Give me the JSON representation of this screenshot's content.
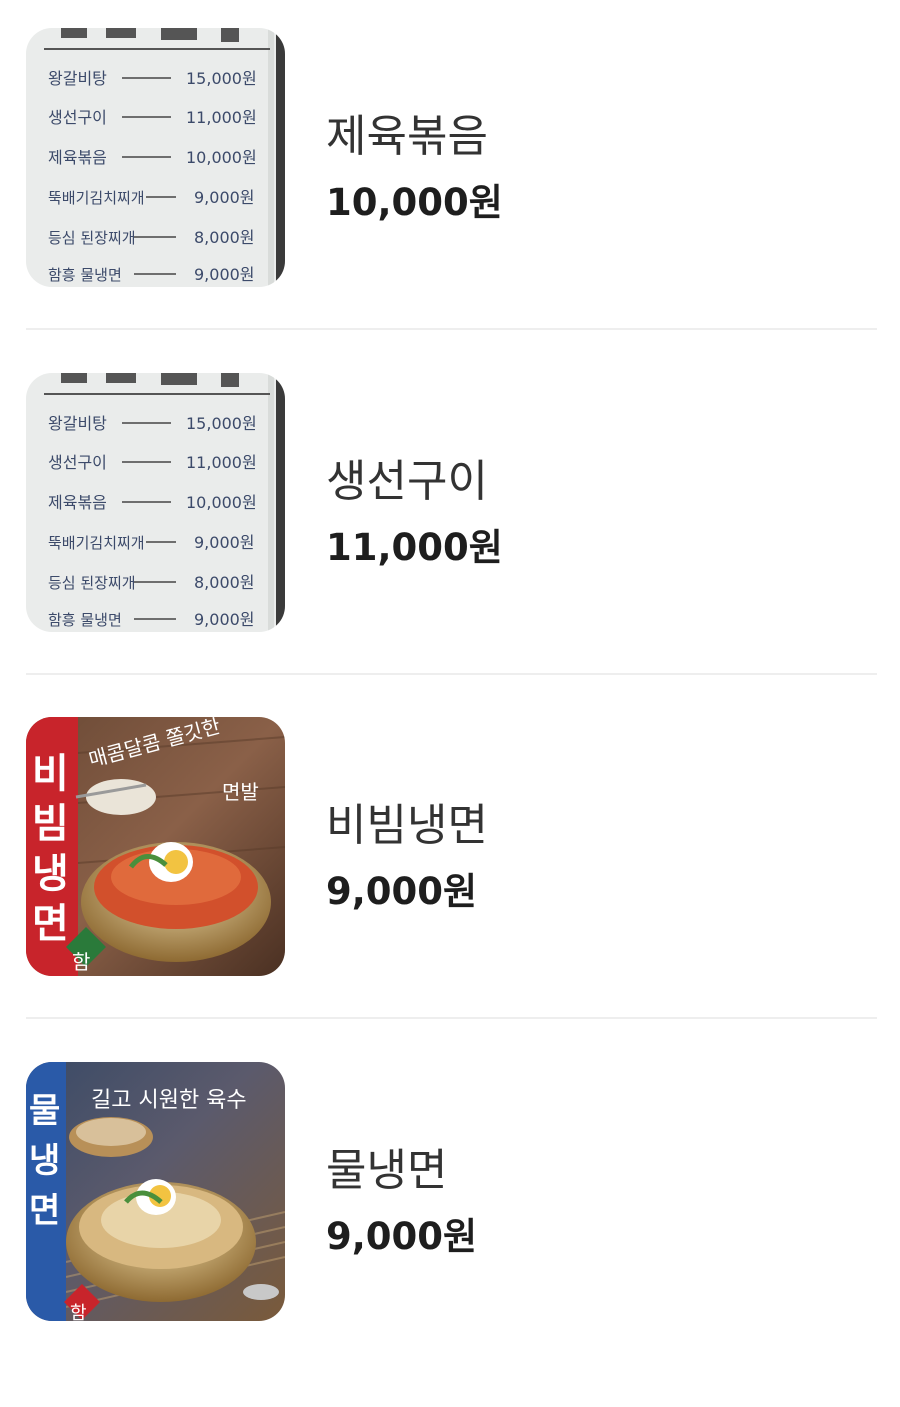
{
  "menu": {
    "items": [
      {
        "name": "제육볶음",
        "price": "10,000원",
        "photo": "menu-board-photo",
        "board": {
          "rows": [
            {
              "name": "왕갈비탕",
              "price": "15,000원"
            },
            {
              "name": "생선구이",
              "price": "11,000원"
            },
            {
              "name": "제육볶음",
              "price": "10,000원"
            },
            {
              "name": "뚝배기김치찌개",
              "price": "9,000원"
            },
            {
              "name": "등심 된장찌개",
              "price": "8,000원"
            },
            {
              "name": "함흥 물냉면",
              "price": "9,000원"
            }
          ]
        }
      },
      {
        "name": "생선구이",
        "price": "11,000원",
        "photo": "menu-board-photo",
        "board": {
          "rows": [
            {
              "name": "왕갈비탕",
              "price": "15,000원"
            },
            {
              "name": "생선구이",
              "price": "11,000원"
            },
            {
              "name": "제육볶음",
              "price": "10,000원"
            },
            {
              "name": "뚝배기김치찌개",
              "price": "9,000원"
            },
            {
              "name": "등심 된장찌개",
              "price": "8,000원"
            },
            {
              "name": "함흥 물냉면",
              "price": "9,000원"
            }
          ]
        }
      },
      {
        "name": "비빔냉면",
        "price": "9,000원",
        "photo": "bibim-naengmyeon-photo",
        "poster": {
          "title": "비빔냉면",
          "slogan_line1": "매콤달콤 쫄깃한",
          "slogan_line2": "면발",
          "badge": "함"
        }
      },
      {
        "name": "물냉면",
        "price": "9,000원",
        "photo": "mul-naengmyeon-photo",
        "poster": {
          "title": "물냉면",
          "slogan_line1": "길고 시원한 육수",
          "badge": "함"
        }
      }
    ]
  },
  "colors": {
    "text_primary": "#333333",
    "text_price": "#1e1e1e",
    "divider": "#eeeeee",
    "poster_red": "#c8242b",
    "board_paper": "#eef0ee"
  }
}
